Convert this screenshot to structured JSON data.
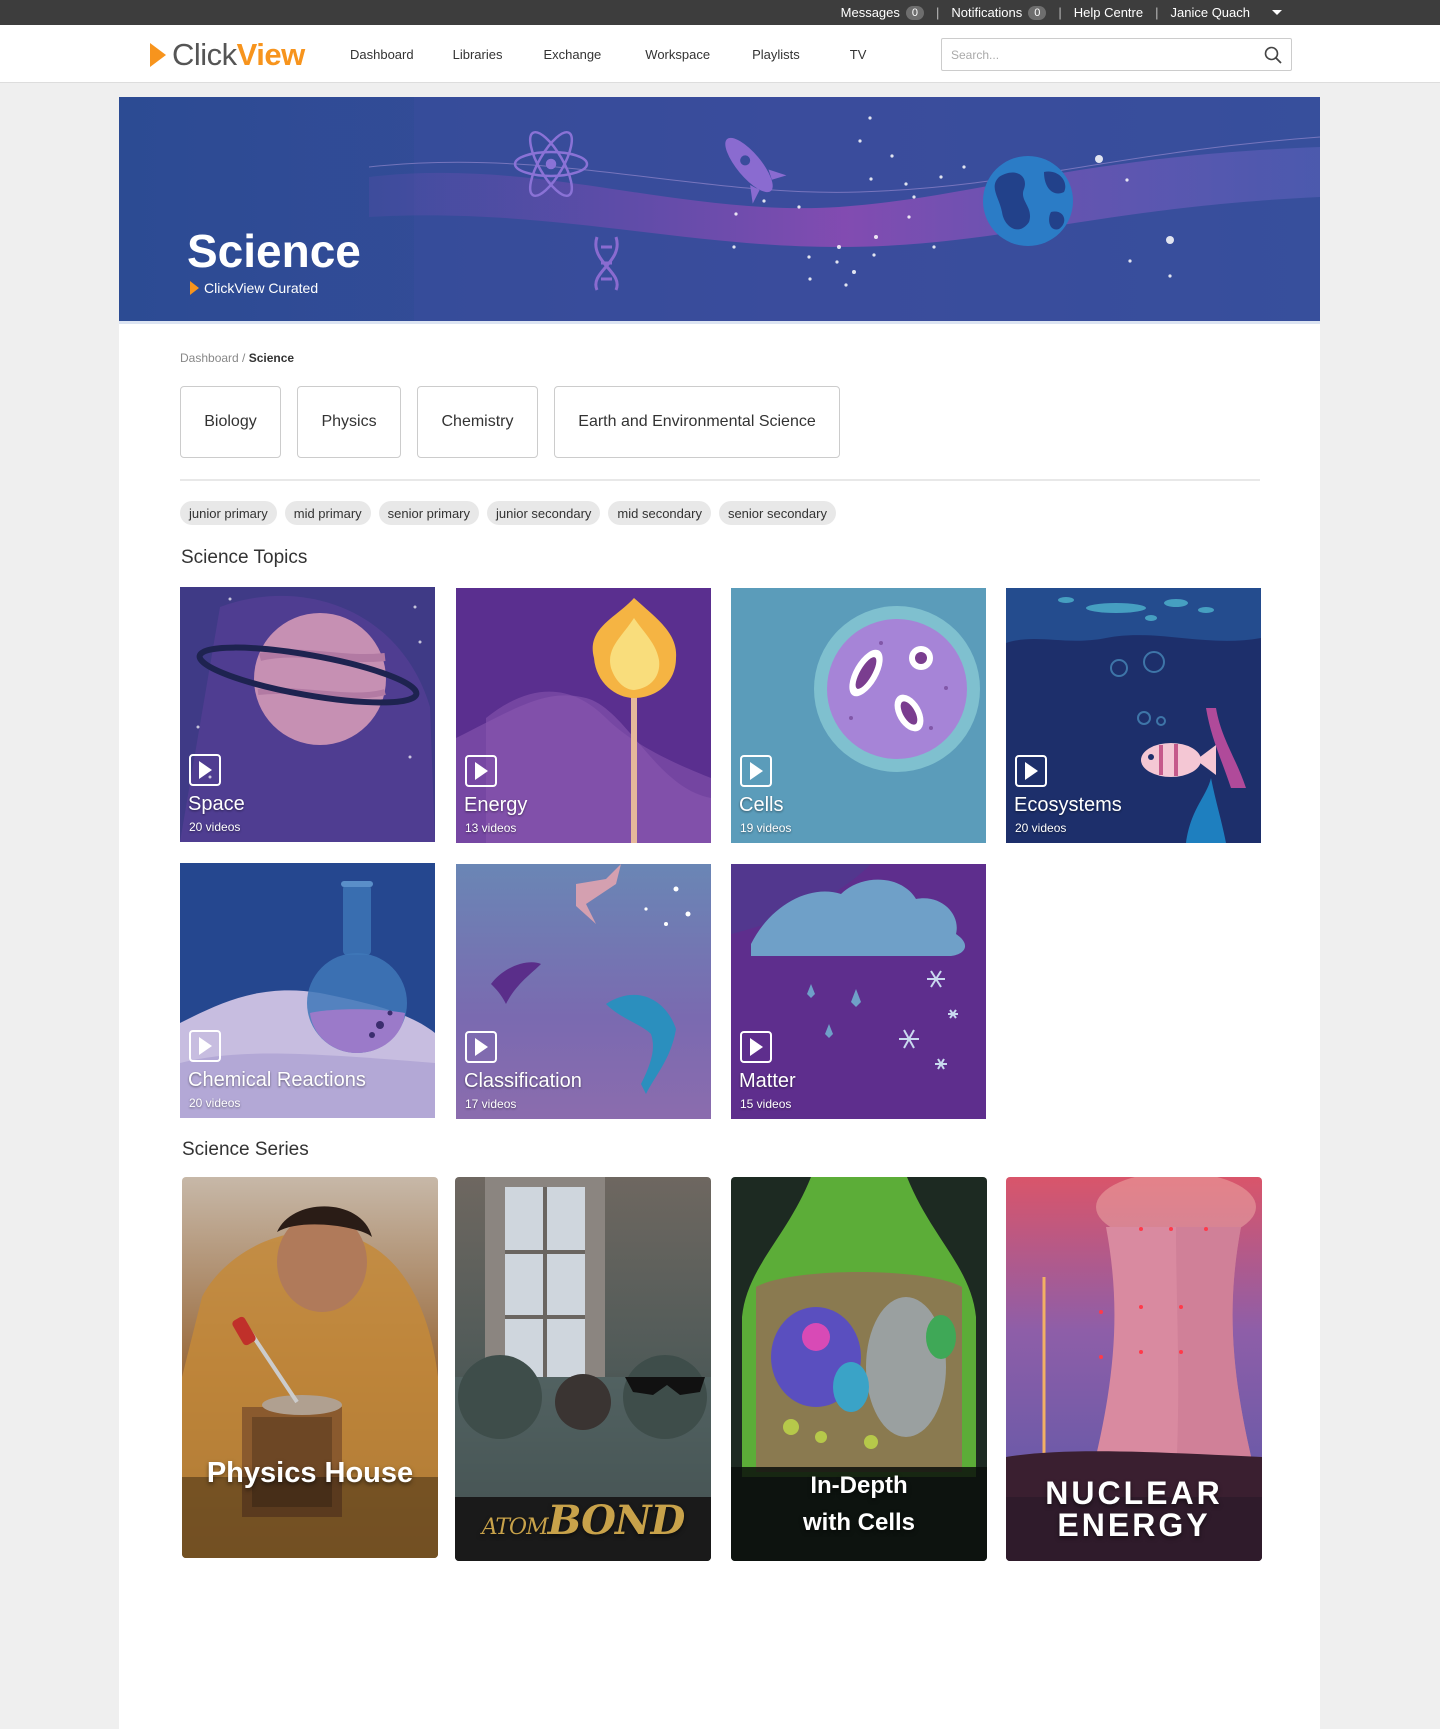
{
  "topbar": {
    "messages_label": "Messages",
    "messages_count": "0",
    "notifications_label": "Notifications",
    "notifications_count": "0",
    "help_label": "Help Centre",
    "user_name": "Janice Quach"
  },
  "nav": {
    "logo_click": "Click",
    "logo_view": "View",
    "links": [
      "Dashboard",
      "Libraries",
      "Exchange",
      "Workspace",
      "Playlists",
      "TV"
    ],
    "search_placeholder": "Search..."
  },
  "banner": {
    "title": "Science",
    "subtitle": "ClickView Curated"
  },
  "breadcrumb": {
    "root": "Dashboard",
    "separator": " / ",
    "current": "Science"
  },
  "subjects": [
    "Biology",
    "Physics",
    "Chemistry",
    "Earth and Environmental Science"
  ],
  "year_levels": [
    "junior primary",
    "mid primary",
    "senior primary",
    "junior secondary",
    "mid secondary",
    "senior secondary"
  ],
  "topics_section": {
    "title": "Science Topics",
    "topics": [
      {
        "name": "Space",
        "count": "20 videos"
      },
      {
        "name": "Energy",
        "count": "13 videos"
      },
      {
        "name": "Cells",
        "count": "19 videos"
      },
      {
        "name": "Ecosystems",
        "count": "20 videos"
      },
      {
        "name": "Chemical Reactions",
        "count": "20 videos"
      },
      {
        "name": "Classification",
        "count": "17 videos"
      },
      {
        "name": "Matter",
        "count": "15 videos"
      }
    ]
  },
  "series_section": {
    "title": "Science Series",
    "series": [
      {
        "title": "Physics House"
      },
      {
        "title_a": "ATOM",
        "title_b": "BOND"
      },
      {
        "title_line1": "In-Depth",
        "title_line2": "with Cells"
      },
      {
        "title_line1": "NUCLEAR",
        "title_line2": "ENERGY"
      }
    ]
  },
  "colors": {
    "brand_orange": "#f7941d",
    "banner_blue": "#2f4f98",
    "topbar": "#3d3d3d"
  }
}
